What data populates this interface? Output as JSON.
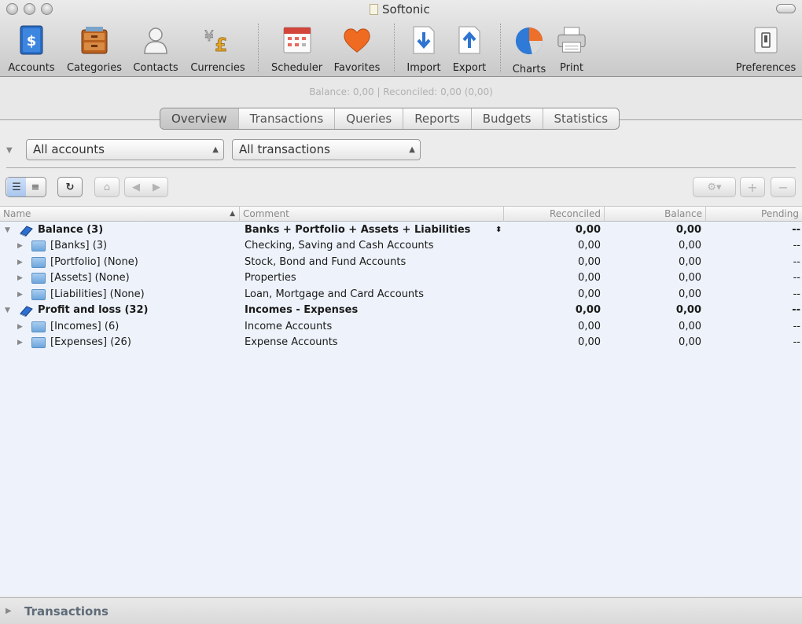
{
  "window": {
    "title": "Softonic"
  },
  "toolbar": {
    "accounts": "Accounts",
    "categories": "Categories",
    "contacts": "Contacts",
    "currencies": "Currencies",
    "scheduler": "Scheduler",
    "favorites": "Favorites",
    "import": "Import",
    "export": "Export",
    "charts": "Charts",
    "print": "Print",
    "preferences": "Preferences"
  },
  "status": {
    "balance_line": "Balance: 0,00 | Reconciled: 0,00 (0,00)"
  },
  "tabs": {
    "overview": "Overview",
    "transactions": "Transactions",
    "queries": "Queries",
    "reports": "Reports",
    "budgets": "Budgets",
    "statistics": "Statistics",
    "active": "overview"
  },
  "filters": {
    "accounts_select": "All accounts",
    "transactions_select": "All transactions"
  },
  "table": {
    "headers": {
      "name": "Name",
      "comment": "Comment",
      "reconciled": "Reconciled",
      "balance": "Balance",
      "pending": "Pending"
    },
    "rows": [
      {
        "name": "Balance (3)",
        "comment": "Banks + Portfolio + Assets + Liabilities",
        "reconciled": "0,00",
        "balance": "0,00",
        "pending": "--"
      },
      {
        "name": "[Banks] (3)",
        "comment": "Checking, Saving and Cash Accounts",
        "reconciled": "0,00",
        "balance": "0,00",
        "pending": "--"
      },
      {
        "name": "[Portfolio] (None)",
        "comment": "Stock, Bond and Fund Accounts",
        "reconciled": "0,00",
        "balance": "0,00",
        "pending": "--"
      },
      {
        "name": "[Assets] (None)",
        "comment": "Properties",
        "reconciled": "0,00",
        "balance": "0,00",
        "pending": "--"
      },
      {
        "name": "[Liabilities] (None)",
        "comment": "Loan, Mortgage and Card Accounts",
        "reconciled": "0,00",
        "balance": "0,00",
        "pending": "--"
      },
      {
        "name": "Profit and loss (32)",
        "comment": "Incomes - Expenses",
        "reconciled": "0,00",
        "balance": "0,00",
        "pending": "--"
      },
      {
        "name": "[Incomes] (6)",
        "comment": "Income Accounts",
        "reconciled": "0,00",
        "balance": "0,00",
        "pending": "--"
      },
      {
        "name": "[Expenses] (26)",
        "comment": "Expense Accounts",
        "reconciled": "0,00",
        "balance": "0,00",
        "pending": "--"
      }
    ]
  },
  "bottom_panel": {
    "title": "Transactions"
  },
  "colors": {
    "accent_selected": "#a9c6ee",
    "table_background": "#eef3fb",
    "folder_blue": "#6ea5dd"
  }
}
